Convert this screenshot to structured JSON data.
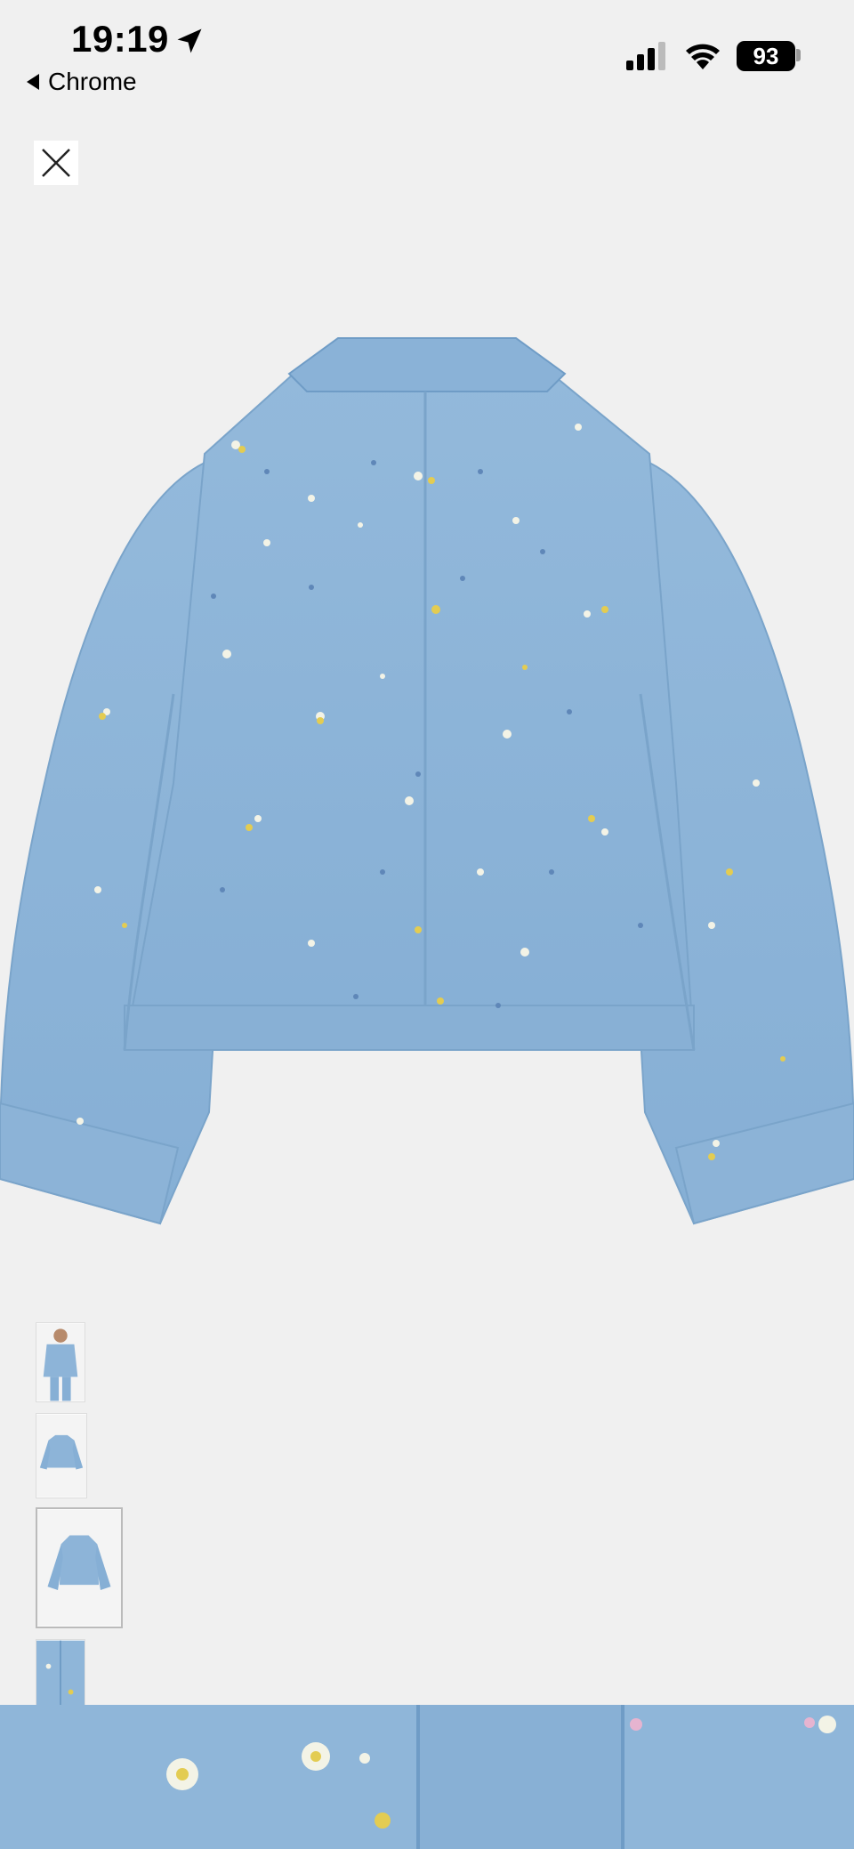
{
  "status_bar": {
    "time": "19:19",
    "back_app_label": "Chrome",
    "battery_level": "93",
    "location_icon": "location-arrow-icon",
    "signal_icon": "cellular-signal-icon",
    "wifi_icon": "wifi-icon"
  },
  "gallery": {
    "close_icon": "close-icon",
    "selected_thumbnail": 3,
    "thumbnail_count": 4
  },
  "colors": {
    "background": "#f0f0f0",
    "denim": "#8fb6d9",
    "denim_dark": "#6f9cc6"
  }
}
